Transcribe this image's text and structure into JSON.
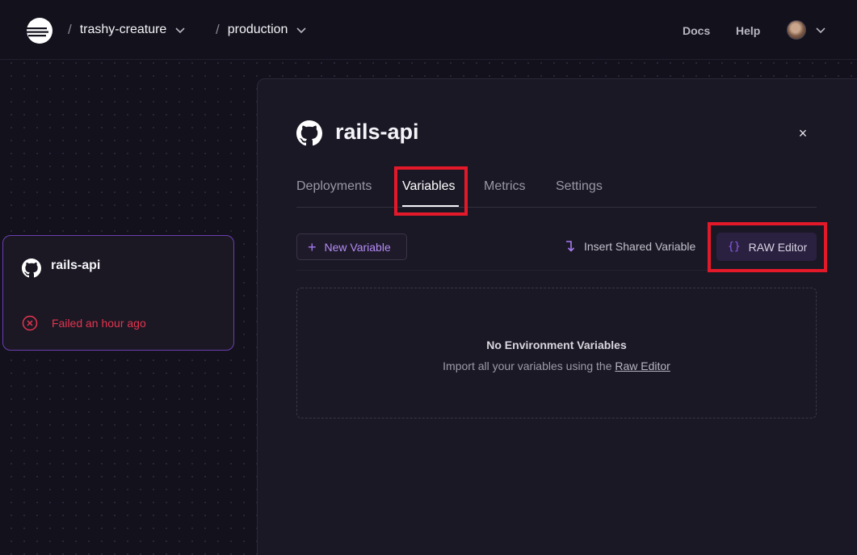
{
  "header": {
    "breadcrumbs": [
      {
        "label": "trashy-creature"
      },
      {
        "label": "production"
      }
    ],
    "separator": "/",
    "nav": {
      "docs": "Docs",
      "help": "Help"
    }
  },
  "service_card": {
    "name": "rails-api",
    "status": "Failed an hour ago",
    "status_color": "#e4354f"
  },
  "panel": {
    "title": "rails-api",
    "close": "×",
    "tabs": [
      {
        "label": "Deployments"
      },
      {
        "label": "Variables",
        "active": true
      },
      {
        "label": "Metrics"
      },
      {
        "label": "Settings"
      }
    ],
    "actions": {
      "new_variable": "New Variable",
      "new_variable_icon": "+",
      "insert_shared": "Insert Shared Variable",
      "raw_editor": "RAW Editor",
      "raw_editor_icon": "{}"
    },
    "empty": {
      "title": "No Environment Variables",
      "subtitle_prefix": "Import all your variables using the",
      "subtitle_link": "Raw Editor"
    }
  },
  "colors": {
    "accent": "#8c5ee8",
    "highlight": "#e3192a",
    "background": "#13111c"
  }
}
